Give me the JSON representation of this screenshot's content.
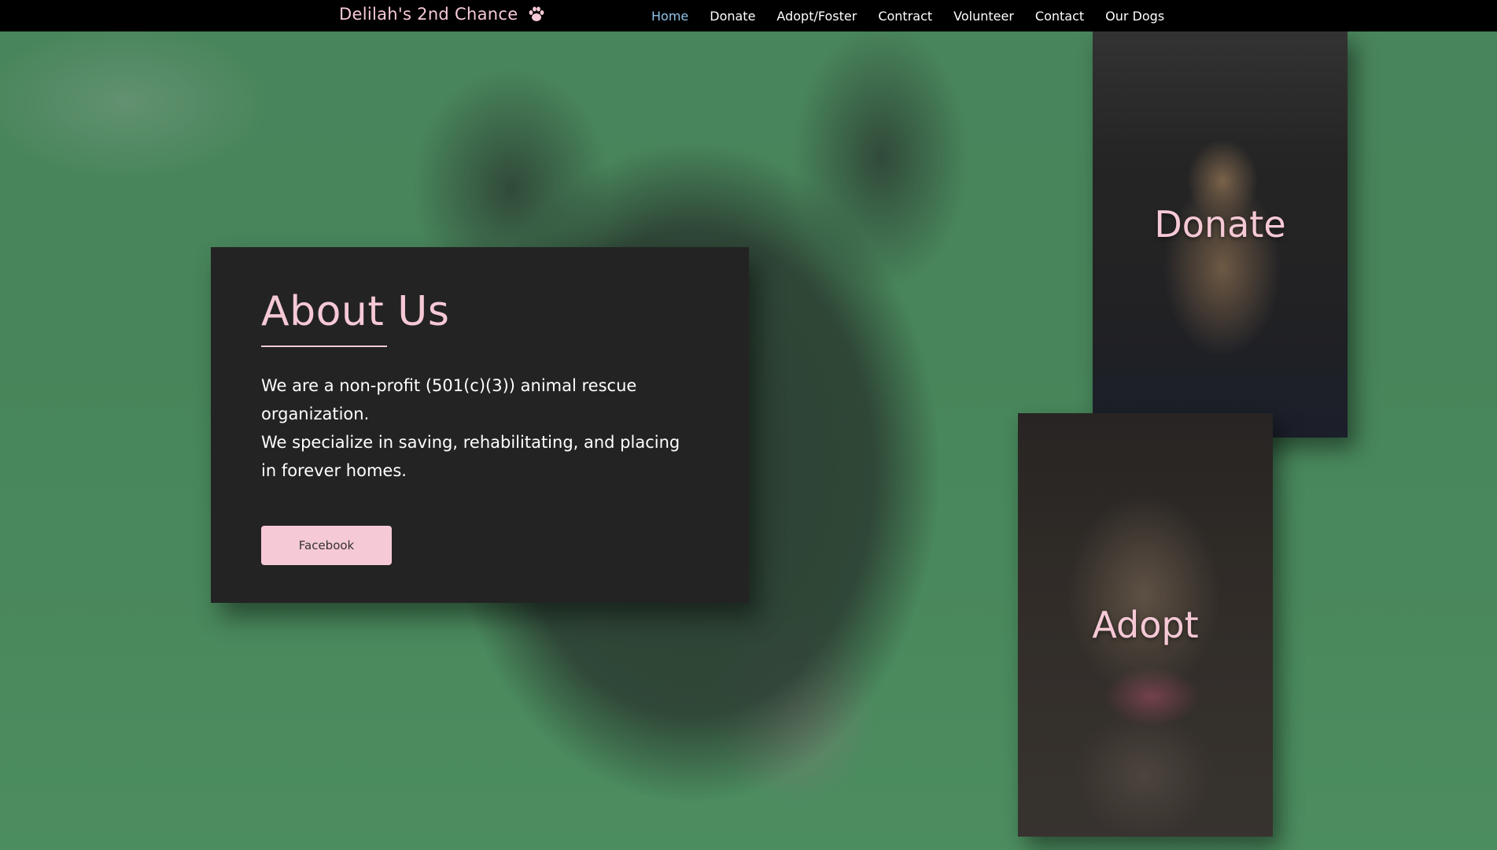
{
  "nav": {
    "brand": "Delilah's 2nd Chance",
    "brand_icon": "paw-icon",
    "links": [
      {
        "label": "Home",
        "active": true
      },
      {
        "label": "Donate",
        "active": false
      },
      {
        "label": "Adopt/Foster",
        "active": false
      },
      {
        "label": "Contract",
        "active": false
      },
      {
        "label": "Volunteer",
        "active": false
      },
      {
        "label": "Contact",
        "active": false
      },
      {
        "label": "Our Dogs",
        "active": false
      }
    ]
  },
  "about": {
    "title": "About Us",
    "paragraphs": [
      "We are a non-profit (501(c)(3)) animal rescue organization.",
      "We specialize in saving, rehabilitating, and placing in forever homes."
    ],
    "button_label": "Facebook"
  },
  "tiles": {
    "donate_label": "Donate",
    "adopt_label": "Adopt"
  },
  "colors": {
    "accent_pink": "#f6c9d6",
    "active_nav": "#8fc3e8",
    "card_bg": "#232323",
    "nav_bg": "#000000"
  }
}
